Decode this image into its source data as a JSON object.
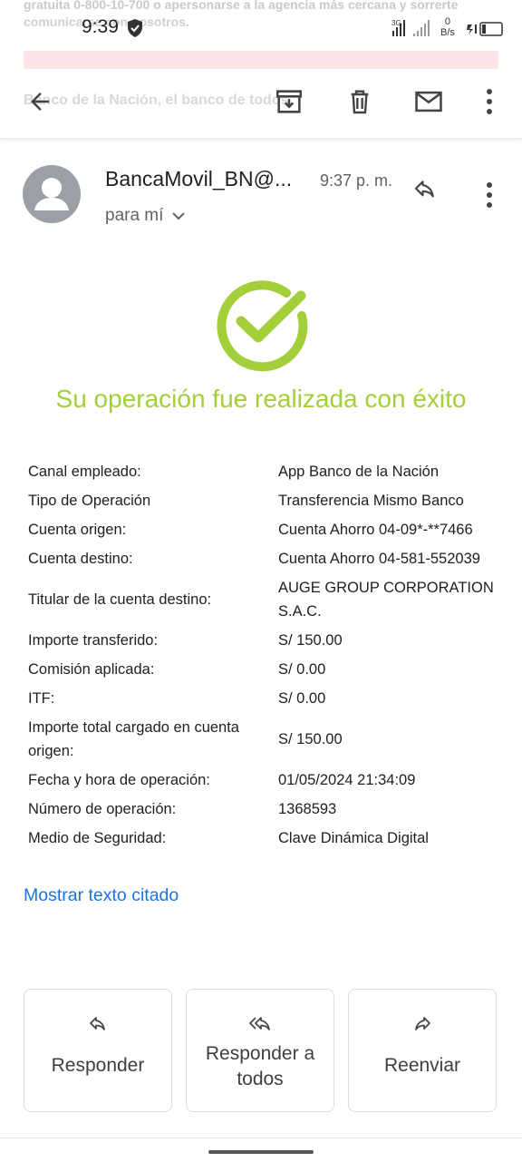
{
  "status_bar": {
    "ghost_line1": "gratuita 0-800-10-700 o apersonarse a la agencia más cercana y sorrerte",
    "ghost_line2": "comunicarse con nosotros.",
    "time": "9:39",
    "network": "3G",
    "speed_value": "0",
    "speed_unit": "B/s"
  },
  "toolbar": {
    "ghost_subject": "Banco de la Nación, el banco de todos",
    "back_icon": "arrow-back-icon",
    "archive_icon": "archive-icon",
    "delete_icon": "trash-icon",
    "mark_icon": "mail-icon",
    "more_icon": "more-vert-icon"
  },
  "email": {
    "sender": "BancaMovil_BN@...",
    "time": "9:37 p. m.",
    "recipient": "para mí"
  },
  "receipt": {
    "title": "Su operación fue realizada con éxito",
    "rows": [
      {
        "label": "Canal empleado:",
        "value": "App Banco de la Nación"
      },
      {
        "label": "Tipo de Operación",
        "value": "Transferencia Mismo Banco"
      },
      {
        "label": "Cuenta origen:",
        "value": "Cuenta Ahorro 04-09*-**7466"
      },
      {
        "label": "Cuenta destino:",
        "value": "Cuenta Ahorro 04-581-552039"
      },
      {
        "label": "Titular de la cuenta destino:",
        "value": "AUGE GROUP CORPORATION S.A.C."
      },
      {
        "label": "Importe transferido:",
        "value": "S/ 150.00"
      },
      {
        "label": "Comisión aplicada:",
        "value": "S/ 0.00"
      },
      {
        "label": "ITF:",
        "value": "S/ 0.00"
      },
      {
        "label": "Importe total cargado en cuenta origen:",
        "value": "S/ 150.00"
      },
      {
        "label": "Fecha y hora de operación:",
        "value": "01/05/2024 21:34:09"
      },
      {
        "label": "Número de operación:",
        "value": "1368593"
      },
      {
        "label": "Medio de Seguridad:",
        "value": "Clave Dinámica Digital"
      }
    ],
    "show_quoted": "Mostrar texto citado"
  },
  "actions": {
    "reply": "Responder",
    "reply_all_line1": "Responder a",
    "reply_all_line2": "todos",
    "forward": "Reenviar"
  },
  "colors": {
    "success_green": "#a3cf3b",
    "link_blue": "#1a73e8"
  }
}
